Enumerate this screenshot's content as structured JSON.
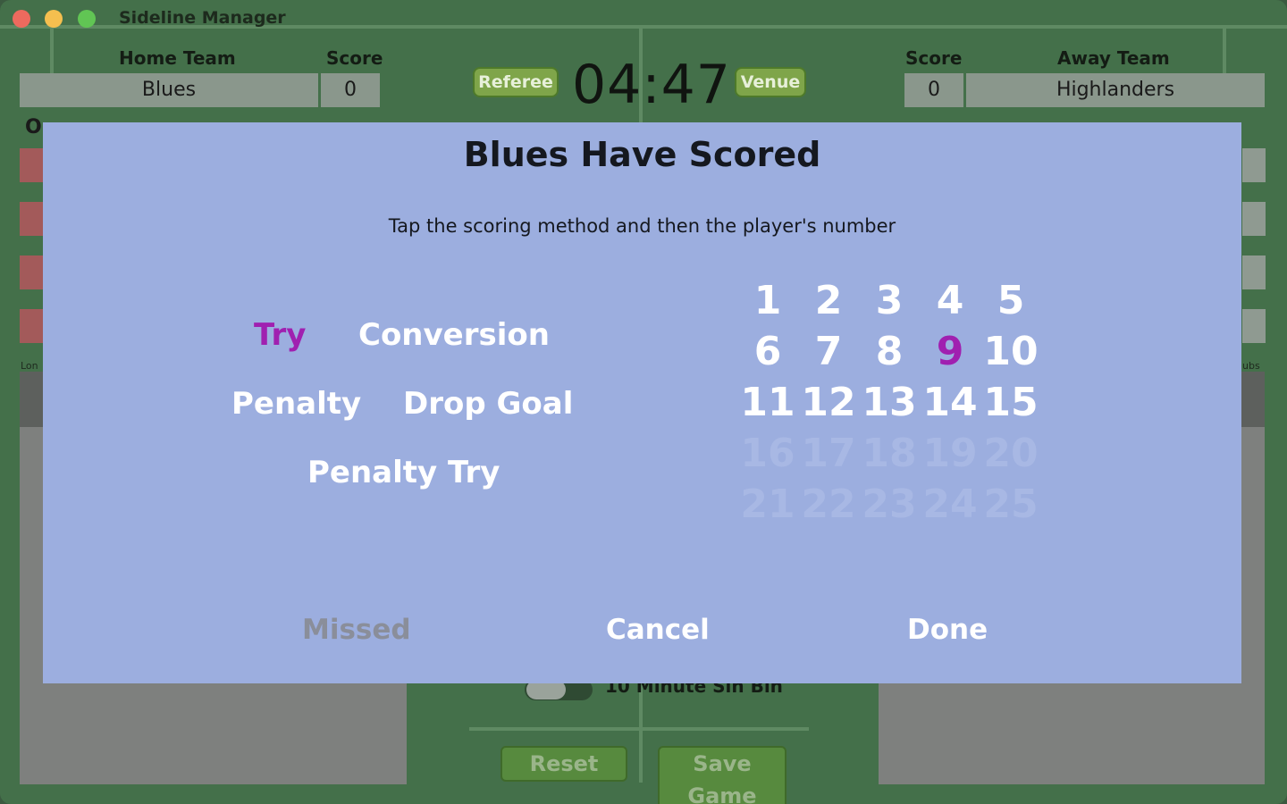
{
  "window": {
    "title": "Sideline Manager"
  },
  "scoreboard": {
    "home_team_label": "Home Team",
    "home_score_label": "Score",
    "home_team": "Blues",
    "home_score": "0",
    "referee_button": "Referee",
    "clock": "04:47",
    "venue_button": "Venue",
    "away_score_label": "Score",
    "away_team_label": "Away Team",
    "away_score": "0",
    "away_team": "Highlanders"
  },
  "background": {
    "sin_bin_label": "10 Minute Sin Bin",
    "reset_button": "Reset",
    "save_game_button": "Save Game"
  },
  "dialog": {
    "title": "Blues Have Scored",
    "instruction": "Tap the scoring method and then the player's number",
    "methods": [
      {
        "label": "Try",
        "selected": true
      },
      {
        "label": "Conversion",
        "selected": false
      },
      {
        "label": "Penalty",
        "selected": false
      },
      {
        "label": "Drop Goal",
        "selected": false
      },
      {
        "label": "Penalty Try",
        "selected": false
      }
    ],
    "player_numbers": [
      "1",
      "2",
      "3",
      "4",
      "5",
      "6",
      "7",
      "8",
      "9",
      "10",
      "11",
      "12",
      "13",
      "14",
      "15",
      "16",
      "17",
      "18",
      "19",
      "20",
      "21",
      "22",
      "23",
      "24",
      "25"
    ],
    "selected_player": "9",
    "missed_button": "Missed",
    "cancel_button": "Cancel",
    "done_button": "Done"
  },
  "colors": {
    "selected": "#a020b0",
    "dialog_bg": "#9caedf",
    "field_green": "#44704a"
  }
}
